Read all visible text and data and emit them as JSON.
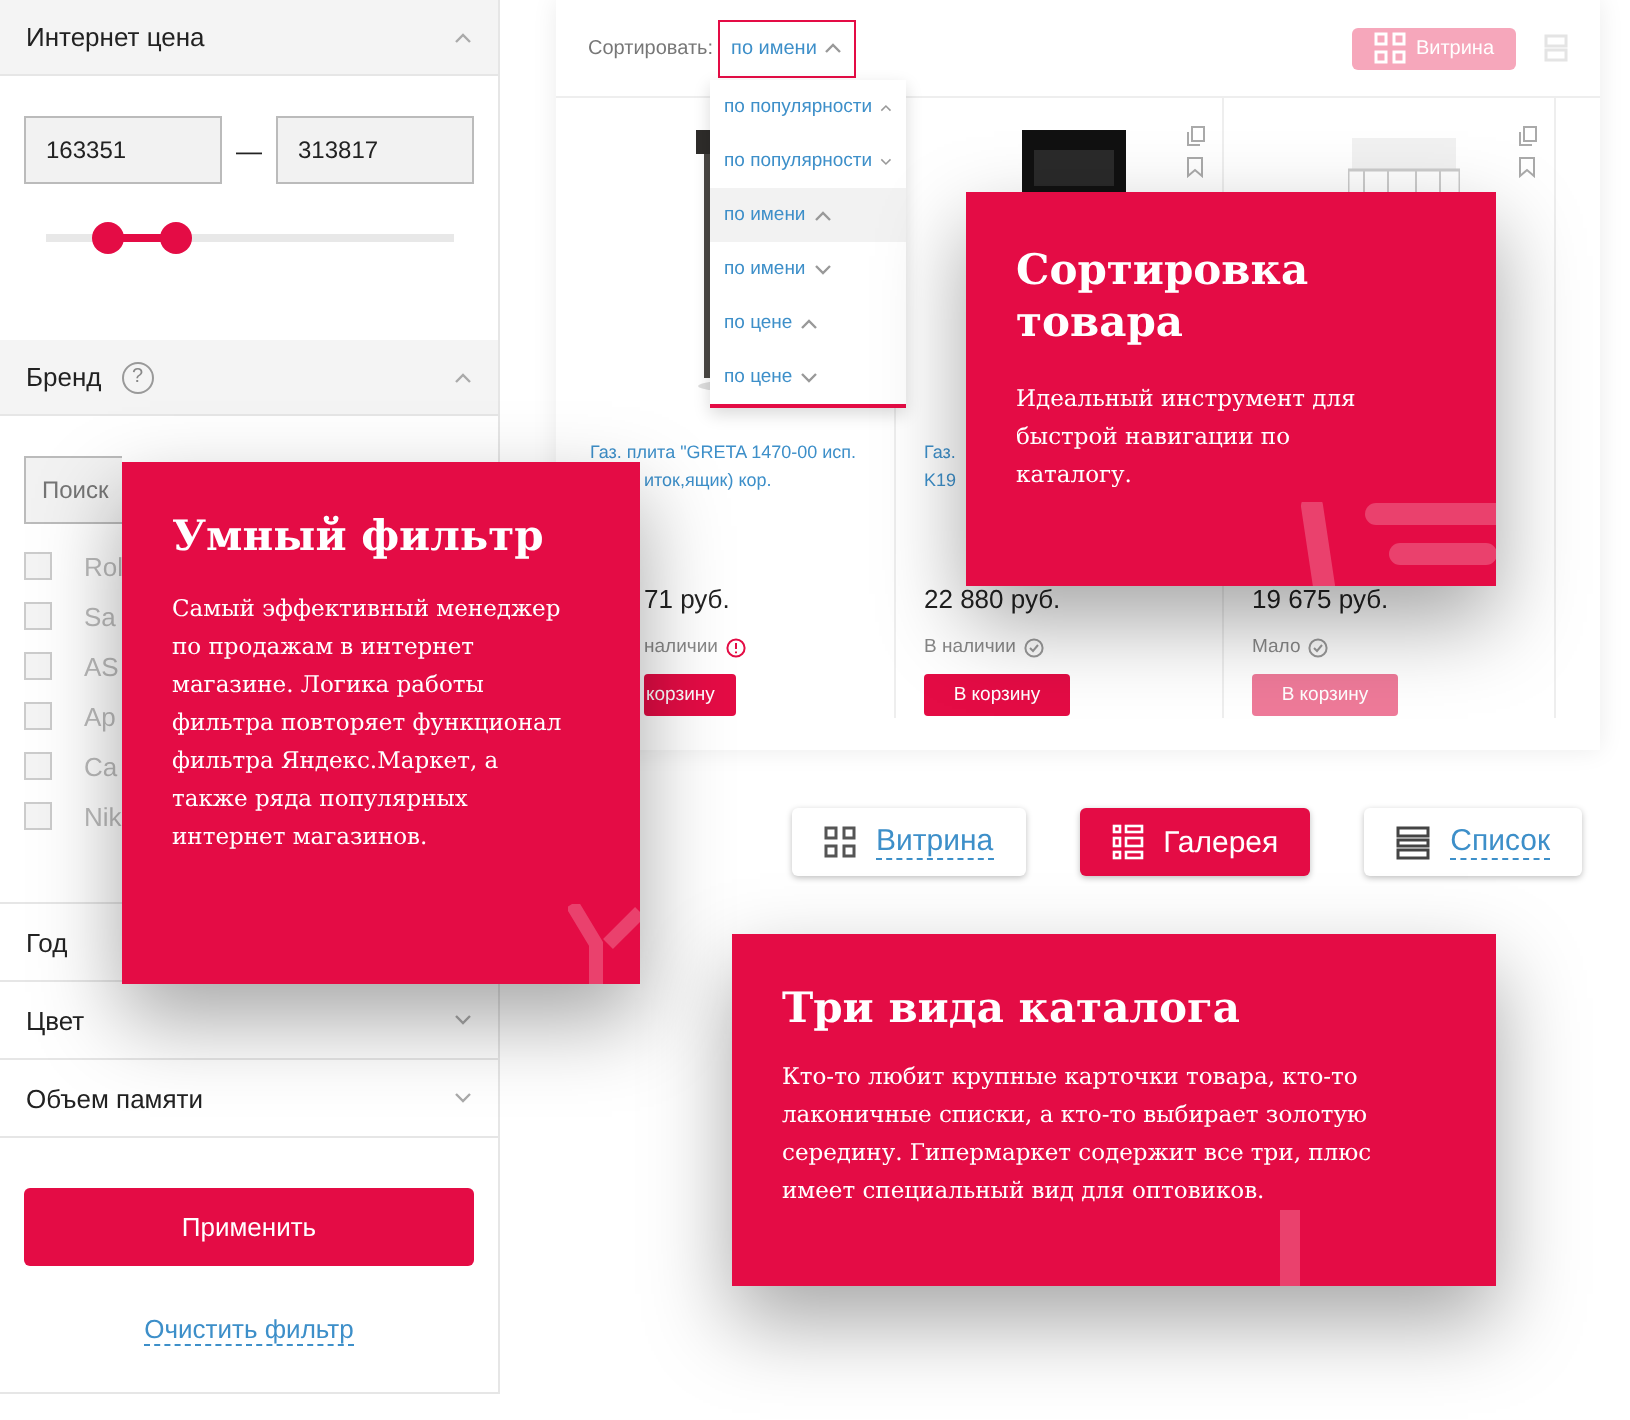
{
  "filter": {
    "price": {
      "title": "Интернет цена",
      "expanded": true,
      "from": "163351",
      "dash": "—",
      "to": "313817",
      "thumbs": [
        {
          "level": 0.15
        },
        {
          "level": 0.32
        }
      ]
    },
    "brand": {
      "title": "Бренд",
      "help": "?",
      "expanded": true,
      "search": {
        "placeholder": "Поиск"
      },
      "options": [
        {
          "label": "Rol",
          "checked": false
        },
        {
          "label": "Sa",
          "checked": false
        },
        {
          "label": "AS",
          "checked": false
        },
        {
          "label": "Ap",
          "checked": false
        },
        {
          "label": "Ca",
          "checked": false
        },
        {
          "label": "Nik",
          "checked": false
        }
      ]
    },
    "sections": [
      {
        "title": "Год"
      },
      {
        "title": "Цвет",
        "expanded": false
      },
      {
        "title": "Объем памяти",
        "expanded": false
      }
    ],
    "apply": "Применить",
    "clear": "Очистить фильтр"
  },
  "catalog": {
    "sort_label": "Сортировать:",
    "sort_value": "по имени",
    "sort_ascending": true,
    "sort_open": true,
    "sort_options": [
      {
        "label": "по популярности",
        "ascending": true,
        "selected": false
      },
      {
        "label": "по популярности",
        "ascending": false,
        "selected": false
      },
      {
        "label": "по имени",
        "ascending": true,
        "selected": true
      },
      {
        "label": "по имени",
        "ascending": false,
        "selected": false
      },
      {
        "label": "по цене",
        "ascending": true,
        "selected": false
      },
      {
        "label": "по цене",
        "ascending": false,
        "selected": false
      }
    ],
    "view_button": "Витрина",
    "products": [
      {
        "name": [
          "Газ. плита \"GRETA 1470-00 исп.",
          "иток,ящик) кор."
        ],
        "price": "71 руб.",
        "stock": "наличии",
        "stock_warning": true,
        "cart": "корзину",
        "cart_active": true
      },
      {
        "name": [
          "Газ.",
          "K19"
        ],
        "price": "22 880 руб.",
        "stock": "В наличии",
        "stock_warning": false,
        "cart": "В корзину",
        "cart_active": true
      },
      {
        "price": "19 675 руб.",
        "stock": "Мало",
        "stock_warning": false,
        "cart": "В корзину",
        "cart_active": false
      }
    ]
  },
  "views": [
    {
      "label": "Витрина",
      "kind": "grid",
      "selected": false
    },
    {
      "label": "Галерея",
      "kind": "gallery",
      "selected": true
    },
    {
      "label": "Список",
      "kind": "list",
      "selected": false
    }
  ],
  "cards": [
    {
      "kind": "filter",
      "title": "Умный фильтр",
      "text": "Самый эффективный менеджер по продажам в интернет магазине. Логика работы фильтра повторяет функционал фильтра Яндекс.Маркет, а также ряда популярных интернет магазинов."
    },
    {
      "kind": "sort",
      "title": "Сортировка товара",
      "text": "Идеальный инструмент для быстрой навигации по каталогу."
    },
    {
      "kind": "views",
      "title": "Три вида каталога",
      "text": "Кто-то любит крупные карточки товара, кто-то лаконичные списки, а кто-то выбирает золотую середину. Гипермаркет содержит все три, плюс имеет специальный вид для оптовиков."
    }
  ]
}
